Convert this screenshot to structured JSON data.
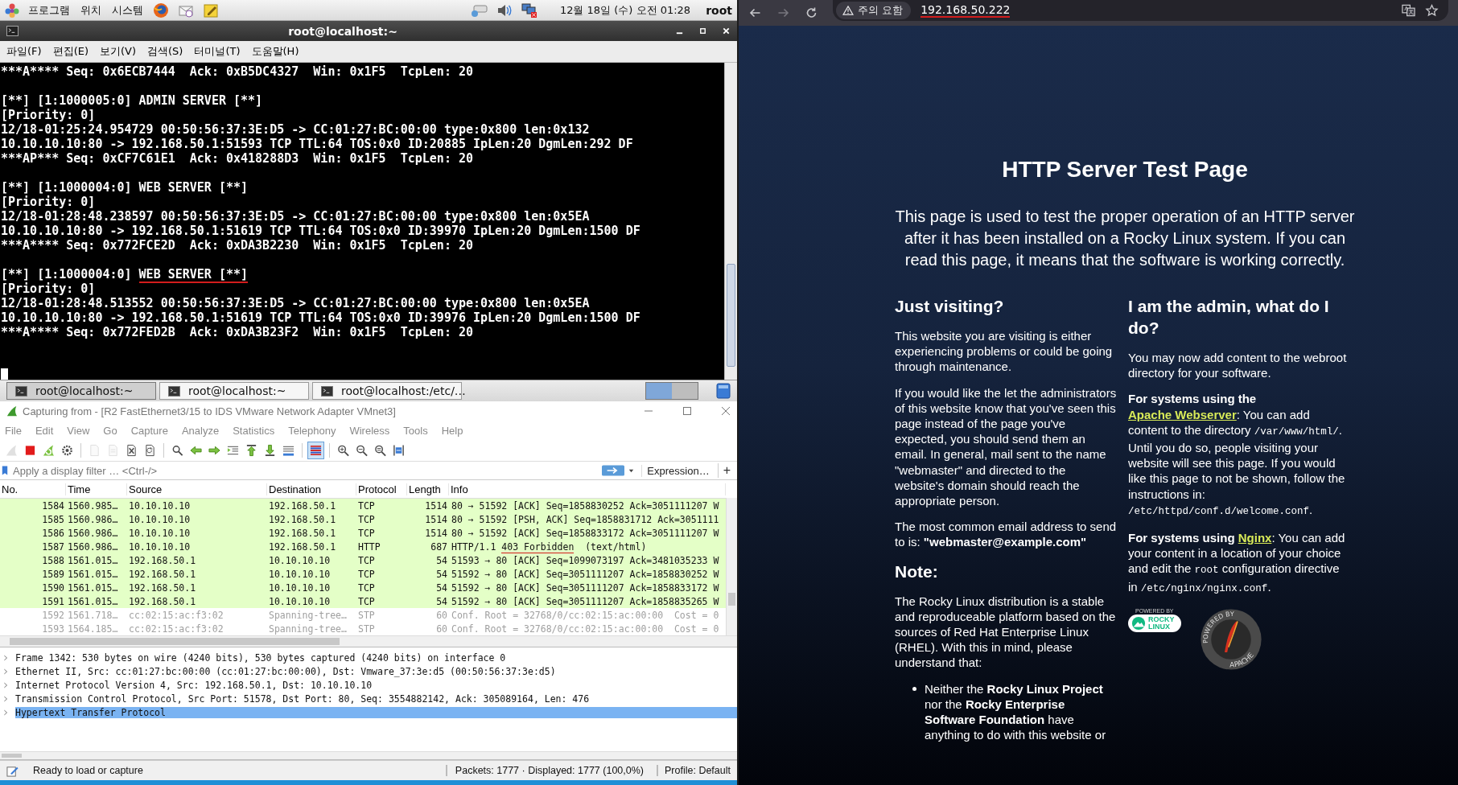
{
  "top_panel": {
    "menus": [
      "프로그램",
      "위치",
      "시스템"
    ],
    "clock": "12월 18일 (수) 오전 01:28",
    "user": "root"
  },
  "terminal": {
    "title": "root@localhost:~",
    "menu": [
      "파일(F)",
      "편집(E)",
      "보기(V)",
      "검색(S)",
      "터미널(T)",
      "도움말(H)"
    ],
    "cursor": true,
    "blocks": [
      {
        "lines": [
          {
            "text": "***A**** Seq: 0x6ECB7444  Ack: 0xB5DC4327  Win: 0x1F5  TcpLen: 20"
          }
        ]
      },
      {
        "lines": [
          {
            "text": "[**] [1:1000005:0] ADMIN SERVER [**]"
          },
          {
            "text": "[Priority: 0]"
          },
          {
            "text": "12/18-01:25:24.954729 00:50:56:37:3E:D5 -> CC:01:27:BC:00:00 type:0x800 len:0x132"
          },
          {
            "text": "10.10.10.10:80 -> 192.168.50.1:51593 TCP TTL:64 TOS:0x0 ID:20885 IpLen:20 DgmLen:292 DF"
          },
          {
            "text": "***AP*** Seq: 0xCF7C61E1  Ack: 0x418288D3  Win: 0x1F5  TcpLen: 20"
          }
        ]
      },
      {
        "lines": [
          {
            "text": "[**] [1:1000004:0] WEB SERVER [**]"
          },
          {
            "text": "[Priority: 0]"
          },
          {
            "text": "12/18-01:28:48.238597 00:50:56:37:3E:D5 -> CC:01:27:BC:00:00 type:0x800 len:0x5EA"
          },
          {
            "text": "10.10.10.10:80 -> 192.168.50.1:51619 TCP TTL:64 TOS:0x0 ID:39970 IpLen:20 DgmLen:1500 DF"
          },
          {
            "text": "***A**** Seq: 0x772FCE2D  Ack: 0xDA3B2230  Win: 0x1F5  TcpLen: 20"
          }
        ]
      },
      {
        "lines": [
          {
            "text": "[**] [1:1000004:0] ",
            "underlined_text": "WEB SERVER [**]"
          },
          {
            "text": "[Priority: 0]"
          },
          {
            "text": "12/18-01:28:48.513552 00:50:56:37:3E:D5 -> CC:01:27:BC:00:00 type:0x800 len:0x5EA"
          },
          {
            "text": "10.10.10.10:80 -> 192.168.50.1:51619 TCP TTL:64 TOS:0x0 ID:39976 IpLen:20 DgmLen:1500 DF"
          },
          {
            "text": "***A**** Seq: 0x772FED2B  Ack: 0xDA3B23F2  Win: 0x1F5  TcpLen: 20"
          }
        ]
      }
    ]
  },
  "taskbar": {
    "tasks": [
      {
        "label": "root@localhost:~",
        "selected": true
      },
      {
        "label": "root@localhost:~",
        "selected": false
      },
      {
        "label": "root@localhost:/etc/…",
        "selected": false
      }
    ],
    "workspaces": [
      {
        "selected": true
      },
      {
        "selected": false
      }
    ]
  },
  "wireshark": {
    "title": "Capturing from - [R2 FastEthernet3/15 to IDS VMware Network Adapter VMnet3]",
    "menu": [
      "File",
      "Edit",
      "View",
      "Go",
      "Capture",
      "Analyze",
      "Statistics",
      "Telephony",
      "Wireless",
      "Tools",
      "Help"
    ],
    "toolbar_groups": [
      {
        "buttons": [
          {
            "kind": "fin",
            "disabled": true,
            "selected": false
          },
          {
            "kind": "stop",
            "disabled": false,
            "selected": false
          },
          {
            "kind": "restart",
            "disabled": false,
            "selected": false
          },
          {
            "kind": "gear",
            "disabled": false,
            "selected": false
          }
        ]
      },
      {
        "buttons": [
          {
            "kind": "file",
            "disabled": true,
            "selected": false
          },
          {
            "kind": "binfile",
            "disabled": true,
            "selected": false
          },
          {
            "kind": "closefile",
            "disabled": false,
            "selected": false
          },
          {
            "kind": "reloadfile",
            "disabled": false,
            "selected": false
          }
        ]
      },
      {
        "buttons": [
          {
            "kind": "search",
            "disabled": false,
            "selected": false
          },
          {
            "kind": "back",
            "disabled": false,
            "selected": false
          },
          {
            "kind": "forward",
            "disabled": false,
            "selected": false
          },
          {
            "kind": "goto",
            "disabled": false,
            "selected": false
          },
          {
            "kind": "first",
            "disabled": false,
            "selected": false
          },
          {
            "kind": "last",
            "disabled": false,
            "selected": false
          },
          {
            "kind": "autoscroll",
            "disabled": false,
            "selected": false
          }
        ]
      },
      {
        "buttons": [
          {
            "kind": "colorize",
            "disabled": false,
            "selected": true
          }
        ]
      },
      {
        "buttons": [
          {
            "kind": "zoomin",
            "disabled": false,
            "selected": false
          },
          {
            "kind": "zoomout",
            "disabled": false,
            "selected": false
          },
          {
            "kind": "zoomreset",
            "disabled": false,
            "selected": false
          },
          {
            "kind": "resize",
            "disabled": false,
            "selected": false
          }
        ]
      }
    ],
    "filter": {
      "placeholder": "Apply a display filter … <Ctrl-/>",
      "expression": "Expression…",
      "add": "+"
    },
    "columns": [
      "No.",
      "Time",
      "Source",
      "Destination",
      "Protocol",
      "Length",
      "Info"
    ],
    "rows": [
      {
        "no": "1584",
        "time": "1560.985…",
        "source": "10.10.10.10",
        "destination": "192.168.50.1",
        "protocol": "TCP",
        "length": "1514",
        "info": "80 → 51592 [ACK] Seq=1858830252 Ack=3051111207 W",
        "color": "#e4ffc7",
        "dimmed": false,
        "selected": false
      },
      {
        "no": "1585",
        "time": "1560.986…",
        "source": "10.10.10.10",
        "destination": "192.168.50.1",
        "protocol": "TCP",
        "length": "1514",
        "info": "80 → 51592 [PSH, ACK] Seq=1858831712 Ack=3051111",
        "color": "#e4ffc7",
        "dimmed": false,
        "selected": false
      },
      {
        "no": "1586",
        "time": "1560.986…",
        "source": "10.10.10.10",
        "destination": "192.168.50.1",
        "protocol": "TCP",
        "length": "1514",
        "info": "80 → 51592 [ACK] Seq=1858833172 Ack=3051111207 W",
        "color": "#e4ffc7",
        "dimmed": false,
        "selected": false
      },
      {
        "no": "1587",
        "time": "1560.986…",
        "source": "10.10.10.10",
        "destination": "192.168.50.1",
        "protocol": "HTTP",
        "length": "687",
        "info": "HTTP/1.1 ",
        "info_underlined": "403 Forbidden",
        "info_rest": "  (text/html)",
        "color": "#e4ffc7",
        "dimmed": false,
        "selected": false
      },
      {
        "no": "1588",
        "time": "1561.015…",
        "source": "192.168.50.1",
        "destination": "10.10.10.10",
        "protocol": "TCP",
        "length": "54",
        "info": "51593 → 80 [ACK] Seq=1099073197 Ack=3481035233 W",
        "color": "#e4ffc7",
        "dimmed": false,
        "selected": false
      },
      {
        "no": "1589",
        "time": "1561.015…",
        "source": "192.168.50.1",
        "destination": "10.10.10.10",
        "protocol": "TCP",
        "length": "54",
        "info": "51592 → 80 [ACK] Seq=3051111207 Ack=1858830252 W",
        "color": "#e4ffc7",
        "dimmed": false,
        "selected": false
      },
      {
        "no": "1590",
        "time": "1561.015…",
        "source": "192.168.50.1",
        "destination": "10.10.10.10",
        "protocol": "TCP",
        "length": "54",
        "info": "51592 → 80 [ACK] Seq=3051111207 Ack=1858833172 W",
        "color": "#e4ffc7",
        "dimmed": false,
        "selected": false
      },
      {
        "no": "1591",
        "time": "1561.015…",
        "source": "192.168.50.1",
        "destination": "10.10.10.10",
        "protocol": "TCP",
        "length": "54",
        "info": "51592 → 80 [ACK] Seq=3051111207 Ack=1858835265 W",
        "color": "#e4ffc7",
        "dimmed": false,
        "selected": false
      },
      {
        "no": "1592",
        "time": "1561.718…",
        "source": "cc:02:15:ac:f3:02",
        "destination": "Spanning-tree…",
        "protocol": "STP",
        "length": "60",
        "info": "Conf. Root = 32768/0/cc:02:15:ac:00:00  Cost = 0",
        "color": "#ffffff",
        "dimmed": true,
        "selected": false
      },
      {
        "no": "1593",
        "time": "1564.185…",
        "source": "cc:02:15:ac:f3:02",
        "destination": "Spanning-tree…",
        "protocol": "STP",
        "length": "60",
        "info": "Conf. Root = 32768/0/cc:02:15:ac:00:00  Cost = 0",
        "color": "#ffffff",
        "dimmed": true,
        "selected": false
      }
    ],
    "details": [
      {
        "text": "Frame 1342: 530 bytes on wire (4240 bits), 530 bytes captured (4240 bits) on interface 0",
        "expanded": false,
        "selected": false
      },
      {
        "text": "Ethernet II, Src: cc:01:27:bc:00:00 (cc:01:27:bc:00:00), Dst: Vmware_37:3e:d5 (00:50:56:37:3e:d5)",
        "expanded": false,
        "selected": false
      },
      {
        "text": "Internet Protocol Version 4, Src: 192.168.50.1, Dst: 10.10.10.10",
        "expanded": false,
        "selected": false
      },
      {
        "text": "Transmission Control Protocol, Src Port: 51578, Dst Port: 80, Seq: 3554882142, Ack: 305089164, Len: 476",
        "expanded": false,
        "selected": false
      },
      {
        "text": "Hypertext Transfer Protocol",
        "expanded": false,
        "selected": true
      }
    ],
    "status": {
      "message": "Ready to load or capture",
      "packets": "Packets: 1777 · Displayed: 1777 (100,0%)",
      "profile": "Profile: Default"
    }
  },
  "browser": {
    "security": "주의 요함",
    "url": "192.168.50.222",
    "url_underlined": true,
    "page": {
      "title": "HTTP Server Test Page",
      "intro": "This page is used to test the proper operation of an HTTP server after it has been installed on a Rocky Linux system. If you can read this page, it means that the software is working correctly.",
      "columns": [
        {
          "heading": "Just visiting?",
          "blocks": [
            {
              "kind": "paragraph",
              "parts": [
                {
                  "kind": "plain",
                  "text": "This website you are visiting is either experiencing problems or could be going through maintenance."
                }
              ]
            },
            {
              "kind": "paragraph",
              "parts": [
                {
                  "kind": "plain",
                  "text": "If you would like the let the administrators of this website know that you've seen this page instead of the page you've expected, you should send them an email. In general, mail sent to the name \"webmaster\" and directed to the website's domain should reach the appropriate person."
                }
              ]
            },
            {
              "kind": "paragraph",
              "parts": [
                {
                  "kind": "plain",
                  "text": "The most common email address to send to is: "
                },
                {
                  "kind": "bold",
                  "text": "\"webmaster@example.com\""
                }
              ]
            },
            {
              "kind": "heading",
              "text": "Note:"
            },
            {
              "kind": "paragraph",
              "parts": [
                {
                  "kind": "plain",
                  "text": "The Rocky Linux distribution is a stable and reproduceable platform based on the sources of Red Hat Enterprise Linux (RHEL). With this in mind, please understand that:"
                }
              ]
            },
            {
              "kind": "bullet",
              "parts": [
                {
                  "kind": "plain",
                  "text": "Neither the "
                },
                {
                  "kind": "bold",
                  "text": "Rocky Linux Project"
                },
                {
                  "kind": "plain",
                  "text": " nor the "
                },
                {
                  "kind": "bold",
                  "text": "Rocky Enterprise Software Foundation"
                },
                {
                  "kind": "plain",
                  "text": " have anything to do with this website or"
                }
              ]
            }
          ]
        },
        {
          "heading": "I am the admin, what do I do?",
          "blocks": [
            {
              "kind": "paragraph",
              "parts": [
                {
                  "kind": "plain",
                  "text": "You may now add content to the webroot directory for your software."
                }
              ]
            },
            {
              "kind": "paragraph",
              "parts": [
                {
                  "kind": "bold",
                  "text": "For systems using the "
                },
                {
                  "kind": "link",
                  "text": "Apache Webserver"
                },
                {
                  "kind": "plain",
                  "text": ": You can add content to the directory "
                },
                {
                  "kind": "code",
                  "text": "/var/www/html/"
                },
                {
                  "kind": "plain",
                  "text": ". Until you do so, people visiting your website will see this page. If you would like this page to not be shown, follow the instructions in: "
                },
                {
                  "kind": "code",
                  "text": "/etc/httpd/conf.d/welcome.conf"
                },
                {
                  "kind": "plain",
                  "text": "."
                }
              ]
            },
            {
              "kind": "paragraph",
              "parts": [
                {
                  "kind": "bold",
                  "text": "For systems using "
                },
                {
                  "kind": "link",
                  "text": "Nginx"
                },
                {
                  "kind": "plain",
                  "text": ": You can add your content in a location of your choice and edit the "
                },
                {
                  "kind": "code",
                  "text": "root"
                },
                {
                  "kind": "plain",
                  "text": " configuration directive in "
                },
                {
                  "kind": "code",
                  "text": "/etc/nginx/nginx.conf"
                },
                {
                  "kind": "plain",
                  "text": "."
                }
              ]
            },
            {
              "kind": "logos",
              "logos": [
                {
                  "kind": "rocky",
                  "top": "POWERED BY",
                  "main": "ROCKY",
                  "sub": "LINUX"
                },
                {
                  "kind": "apache",
                  "top": "POWERED BY",
                  "main": "APACHE"
                }
              ]
            }
          ]
        }
      ]
    }
  }
}
